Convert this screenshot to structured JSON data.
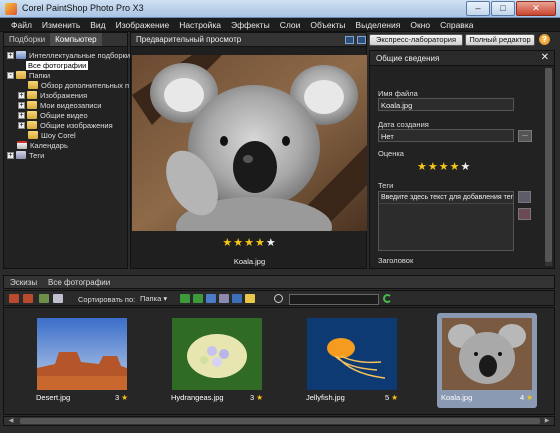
{
  "window": {
    "title": "Corel PaintShop Photo Pro X3",
    "buttons": [
      "–",
      "□",
      "✕"
    ]
  },
  "menu": [
    "Файл",
    "Изменить",
    "Вид",
    "Изображение",
    "Настройка",
    "Эффекты",
    "Слои",
    "Объекты",
    "Выделения",
    "Окно",
    "Справка"
  ],
  "left_panel": {
    "tabs": [
      "Подборки",
      "Компьютер"
    ],
    "active_tab": 1,
    "tree": [
      {
        "label": "Интеллектуальные подборки",
        "icon": "smart-collection-icon",
        "expander": "+"
      },
      {
        "label": "Все фотографии",
        "icon": "",
        "expander": "",
        "selected": true
      },
      {
        "label": "Папки",
        "icon": "folder-icon",
        "expander": "-"
      },
      {
        "label": "Обзор дополнительных п",
        "icon": "folder-icon",
        "expander": ""
      },
      {
        "label": "Изображения",
        "icon": "folder-icon",
        "expander": "+"
      },
      {
        "label": "Мои видеозаписи",
        "icon": "folder-icon",
        "expander": "+"
      },
      {
        "label": "Общие видео",
        "icon": "folder-icon",
        "expander": "+"
      },
      {
        "label": "Общие изображения",
        "icon": "folder-icon",
        "expander": "+"
      },
      {
        "label": "Шоу Corel",
        "icon": "folder-icon",
        "expander": ""
      },
      {
        "label": "Календарь",
        "icon": "calendar-icon",
        "expander": ""
      },
      {
        "label": "Теги",
        "icon": "tags-icon",
        "expander": "+"
      }
    ]
  },
  "preview": {
    "title": "Предварительный просмотр",
    "rating": 4,
    "filename": "Koala.jpg"
  },
  "actions": {
    "express_lab": "Экспресс-лаборатория",
    "full_editor": "Полный редактор",
    "help": "?"
  },
  "info": {
    "title": "Общие сведения",
    "close": "✕",
    "filename_label": "Имя файла",
    "filename_value": "Koala.jpg",
    "date_label": "Дата создания",
    "date_value": "Нет",
    "date_button": "...",
    "rating_label": "Оценка",
    "rating": 4,
    "tags_label": "Теги",
    "tags_placeholder": "Введите здесь текст для добавления тега",
    "heading_label": "Заголовок"
  },
  "strip": {
    "tabs": [
      "Эскизы",
      "Все фотографии"
    ],
    "sort_label": "Сортировать по:",
    "sort_value": "Папка",
    "thumbnails": [
      {
        "name": "Desert.jpg",
        "rating": "3",
        "selected": false
      },
      {
        "name": "Hydrangeas.jpg",
        "rating": "3",
        "selected": false
      },
      {
        "name": "Jellyfish.jpg",
        "rating": "5",
        "selected": false
      },
      {
        "name": "Koala.jpg",
        "rating": "4",
        "selected": true
      }
    ]
  }
}
